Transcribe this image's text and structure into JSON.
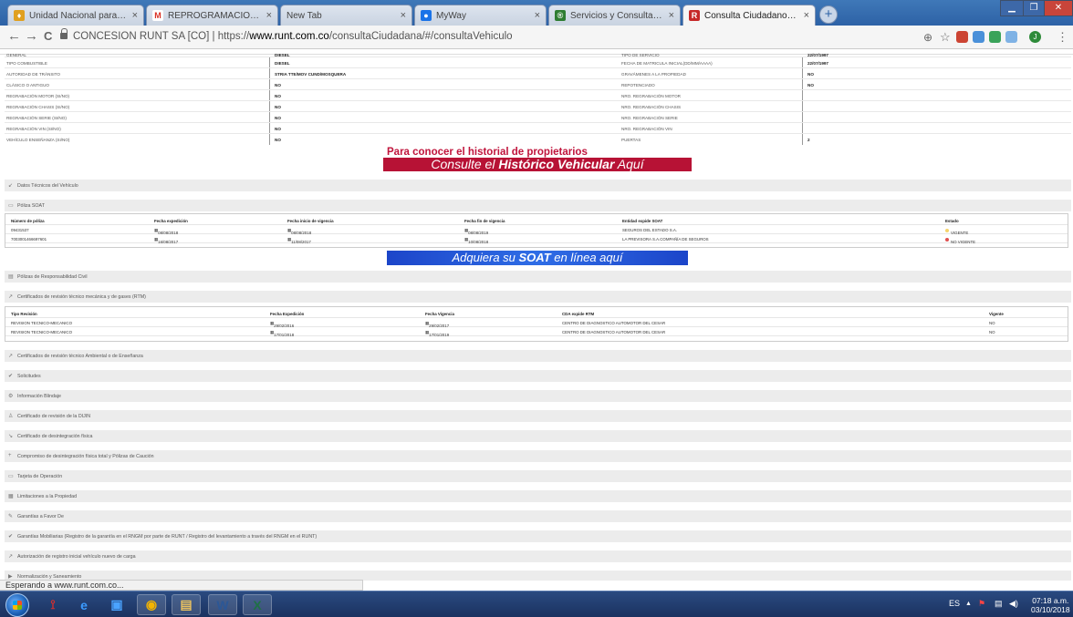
{
  "browser": {
    "tabs": [
      {
        "title": "Unidad Nacional para la Gestión",
        "fav_color": "#e0a020",
        "fav_glyph": "♦"
      },
      {
        "title": "REPROGRAMACION SEGUIMIEN",
        "fav_color": "#d93025",
        "fav_glyph": "M"
      },
      {
        "title": "New Tab",
        "fav_color": "",
        "fav_glyph": ""
      },
      {
        "title": "MyWay",
        "fav_color": "#1a73e8",
        "fav_glyph": "●"
      },
      {
        "title": "Servicios y Consultas en Línea | M",
        "fav_color": "#2e7d32",
        "fav_glyph": "®"
      },
      {
        "title": "Consulta Ciudadano - RUNT",
        "fav_color": "#c62828",
        "fav_glyph": "R"
      }
    ],
    "tab_close": "×",
    "new_tab": "+",
    "url_host": "CONCESION RUNT SA [CO]",
    "url_sep": "|",
    "url_prefix": "https://",
    "url_domain": "www.runt.com.co",
    "url_path": "/consultaCiudadana/#/consultaVehiculo",
    "back": "←",
    "forward": "→",
    "reload": "C",
    "zoom_icon": "⊕",
    "star_icon": "☆",
    "profile": "J",
    "menu": "⋮"
  },
  "vehicle_rows": [
    {
      "l1": "GENERAL",
      "v1": "DIESEL",
      "l2": "TIPO DE SERVICIO",
      "v2": "22/07/1997"
    },
    {
      "l1": "TIPO COMBUSTIBLE",
      "v1": "DIESEL",
      "l2": "FECHA DE MATRICULA INICIAL(DD/MM/AAAA)",
      "v2": "22/07/1997"
    },
    {
      "l1": "AUTORIDAD DE TRÁNSITO",
      "v1": "STRIA TTE/MOV CUND/MOSQUERA",
      "l2": "GRAVÁMENES A LA PROPIEDAD",
      "v2": "NO"
    },
    {
      "l1": "CLÁSICO O ANTIGUO",
      "v1": "NO",
      "l2": "REPOTENCIADO",
      "v2": "NO"
    },
    {
      "l1": "REGRABACIÓN MOTOR (SI/NO)",
      "v1": "NO",
      "l2": "NRO. REGRABACIÓN MOTOR",
      "v2": ""
    },
    {
      "l1": "REGRABACIÓN CHASIS (SI/NO)",
      "v1": "NO",
      "l2": "NRO. REGRABACIÓN CHASIS",
      "v2": ""
    },
    {
      "l1": "REGRABACIÓN SERIE (SI/NO)",
      "v1": "NO",
      "l2": "NRO. REGRABACIÓN SERIE",
      "v2": ""
    },
    {
      "l1": "REGRABACIÓN VIN (SI/NO)",
      "v1": "NO",
      "l2": "NRO. REGRABACIÓN VIN",
      "v2": ""
    },
    {
      "l1": "VEHÍCULO ENSEÑANZA (SI/NO)",
      "v1": "NO",
      "l2": "PUERTAS",
      "v2": "2"
    }
  ],
  "history_banner": {
    "top": "Para conocer el historial de propietarios",
    "pre": "Consulte el ",
    "bold": "Histórico Vehicular",
    "post": " Aquí"
  },
  "sections_a": {
    "datos_tecnicos": "Datos Técnicos del Vehículo",
    "poliza_soat": "Póliza SOAT"
  },
  "soat_table": {
    "headers": [
      "Número de póliza",
      "Fecha expedición",
      "Fecha inicio de vigencia",
      "Fecha fin de vigencia",
      "Entidad expide SOAT",
      "Estado"
    ],
    "rows": [
      [
        "09431537",
        "08/08/2018",
        "08/08/2018",
        "08/08/2019",
        "SEGUROS DEL ESTADO S.A.",
        "VIGENTE"
      ],
      [
        "7003001466697601",
        "16/08/2017",
        "11/08/2017",
        "10/08/2018",
        "LA PREVISORA S.A.COMPAÑÍA DE SEGUROS",
        "NO VIGENTE"
      ]
    ],
    "status_colors": [
      "#f5d36b",
      "#e05050"
    ]
  },
  "soat_banner": {
    "pre": "Adquiera su ",
    "bold": "SOAT",
    "post": " en línea aquí"
  },
  "sections_b": {
    "polizas_rc": "Pólizas de Responsabilidad Civil",
    "rtm": "Certificados de revisión técnico mecánica y de gases (RTM)"
  },
  "rtm_table": {
    "headers": [
      "Tipo Revisión",
      "Fecha Expedición",
      "Fecha Vigencia",
      "CDA expide RTM",
      "Vigente"
    ],
    "rows": [
      [
        "REVISION TECNICO-MECANICO",
        "29/02/2016",
        "29/02/2017",
        "CENTRO DE DIAGNOSTICO AUTOMOTOR DEL CESAR",
        "NO"
      ],
      [
        "REVISION TECNICO-MECANICO",
        "17/01/2018",
        "17/01/2019",
        "CENTRO DE DIAGNOSTICO AUTOMOTOR DEL CESAR",
        "NO"
      ]
    ]
  },
  "sections_c": [
    {
      "icon": "↗",
      "label": "Certificados de revisión técnico Ambiental o de Enseñanza",
      "name": "section-certificados-ambiental"
    },
    {
      "icon": "✔",
      "label": "Solicitudes",
      "name": "section-solicitudes"
    },
    {
      "icon": "⚙",
      "label": "Información Blindaje",
      "name": "section-blindaje"
    },
    {
      "icon": "♙",
      "label": "Certificado de revisión de la DIJIN",
      "name": "section-dijin"
    },
    {
      "icon": "↘",
      "label": "Certificado de desintegración física",
      "name": "section-desintegracion"
    },
    {
      "icon": "+",
      "label": "Compromiso de desintegración física total y Pólizas de Caución",
      "name": "section-compromiso"
    },
    {
      "icon": "▭",
      "label": "Tarjeta de Operación",
      "name": "section-tarjeta-operacion"
    },
    {
      "icon": "▦",
      "label": "Limitaciones a la Propiedad",
      "name": "section-limitaciones"
    },
    {
      "icon": "✎",
      "label": "Garantías a Favor De",
      "name": "section-garantias"
    },
    {
      "icon": "✔",
      "label": "Garantías Mobiliarias (Registro de la garantía en el RNGM por parte de RUNT / Registro del levantamiento a través del RNGM en el RUNT)",
      "name": "section-garantias-mobiliarias"
    },
    {
      "icon": "↗",
      "label": "Autorización de registro inicial vehículo nuevo de carga",
      "name": "section-autorizacion-carga"
    },
    {
      "icon": "▶",
      "label": "Normalización y Saneamiento",
      "name": "section-normalizacion"
    }
  ],
  "status_text": "Esperando a www.runt.com.co...",
  "taskbar": {
    "apps": [
      {
        "glyph": "⟟",
        "color": "#d32f2f",
        "name": "acrobat"
      },
      {
        "glyph": "e",
        "color": "#3b9bff",
        "name": "internet-explorer"
      },
      {
        "glyph": "▣",
        "color": "#4aa3ff",
        "name": "media"
      },
      {
        "glyph": "◉",
        "color": "#f4b400",
        "name": "chrome"
      },
      {
        "glyph": "▤",
        "color": "#e8c060",
        "name": "explorer"
      },
      {
        "glyph": "W",
        "color": "#2b5797",
        "name": "word"
      },
      {
        "glyph": "X",
        "color": "#1e7145",
        "name": "excel"
      }
    ],
    "lang": "ES",
    "tray_up": "▲",
    "time": "07:18 a.m.",
    "date": "03/10/2018"
  },
  "section_icons": {
    "datos_tecnicos": "↙",
    "poliza_soat": "▭",
    "polizas_rc": "▤",
    "rtm": "↗"
  }
}
